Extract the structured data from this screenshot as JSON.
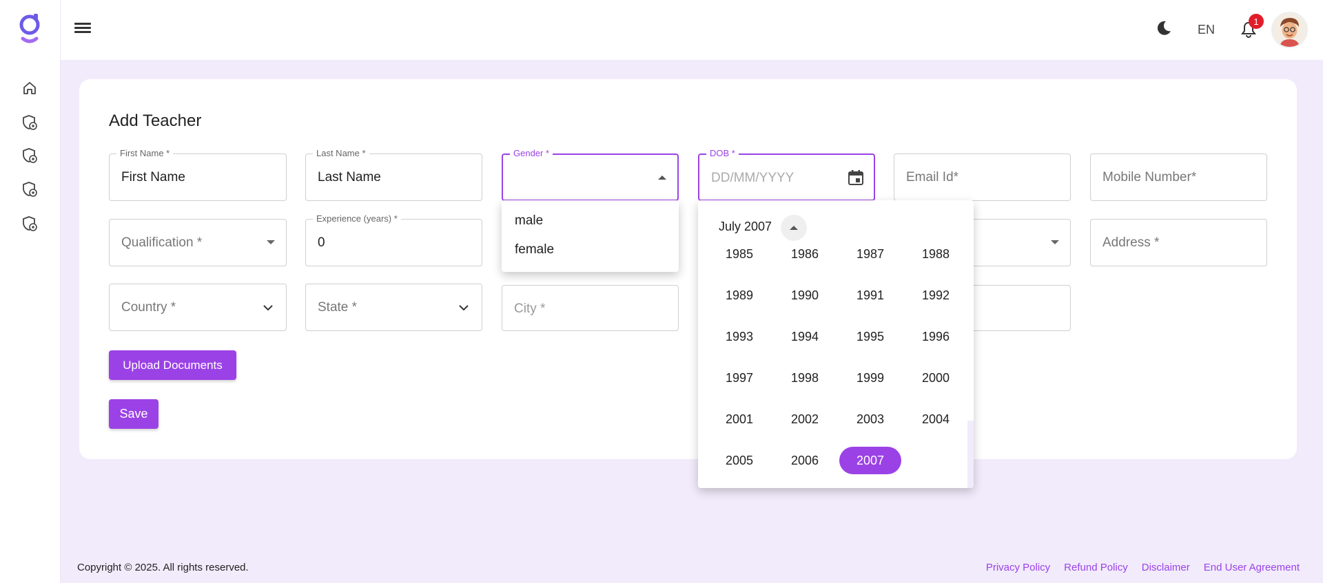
{
  "header": {
    "language": "EN",
    "notification_count": "1"
  },
  "page": {
    "title": "Add Teacher"
  },
  "form": {
    "first_name": {
      "label": "First Name *",
      "value": "First Name"
    },
    "last_name": {
      "label": "Last Name *",
      "value": "Last Name"
    },
    "gender": {
      "label": "Gender *",
      "value": ""
    },
    "dob": {
      "label": "DOB *",
      "placeholder": "DD/MM/YYYY"
    },
    "email": {
      "placeholder": "Email Id*"
    },
    "mobile": {
      "placeholder": "Mobile Number*"
    },
    "qualification": {
      "placeholder": "Qualification *"
    },
    "experience": {
      "label": "Experience (years) *",
      "value": "0"
    },
    "address": {
      "placeholder": "Address *"
    },
    "country": {
      "placeholder": "Country *"
    },
    "state": {
      "placeholder": "State *"
    },
    "city": {
      "placeholder": "City *"
    }
  },
  "buttons": {
    "upload": "Upload Documents",
    "save": "Save"
  },
  "gender_menu": {
    "options": [
      "male",
      "female"
    ]
  },
  "date_picker": {
    "month_label": "July 2007",
    "years": [
      "1985",
      "1986",
      "1987",
      "1988",
      "1989",
      "1990",
      "1991",
      "1992",
      "1993",
      "1994",
      "1995",
      "1996",
      "1997",
      "1998",
      "1999",
      "2000",
      "2001",
      "2002",
      "2003",
      "2004",
      "2005",
      "2006",
      "2007"
    ],
    "selected_year": "2007"
  },
  "footer": {
    "copyright": "Copyright © 2025. All rights reserved.",
    "links": [
      "Privacy Policy",
      "Refund Policy",
      "Disclaimer",
      "End User Agreement"
    ]
  },
  "colors": {
    "accent": "#9b42e6",
    "background": "#f1ebfb",
    "badge": "#e11d2a"
  },
  "icons": [
    "logo-icon",
    "home-icon",
    "shield-icon",
    "menu-icon",
    "moon-icon",
    "bell-icon",
    "calendar-icon",
    "chevron-down-icon"
  ]
}
